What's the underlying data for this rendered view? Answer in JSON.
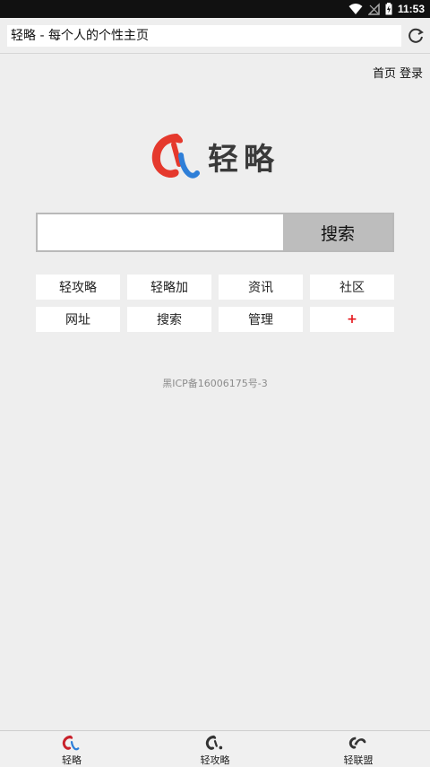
{
  "status_bar": {
    "time": "11:53",
    "icons": [
      "wifi-icon",
      "no-signal-icon",
      "battery-charging-icon"
    ]
  },
  "address_bar": {
    "title": "轻略 - 每个人的个性主页",
    "refresh_icon": "refresh-icon"
  },
  "top_links": {
    "home": "首页",
    "login": "登录"
  },
  "logo": {
    "text": "轻略",
    "colors": {
      "red": "#e5392d",
      "blue": "#2f7fd8"
    }
  },
  "search": {
    "value": "",
    "placeholder": "",
    "button_label": "搜索"
  },
  "quick_links": [
    {
      "label": "轻攻略"
    },
    {
      "label": "轻略加"
    },
    {
      "label": "资讯"
    },
    {
      "label": "社区"
    },
    {
      "label": "网址"
    },
    {
      "label": "搜索"
    },
    {
      "label": "管理"
    },
    {
      "label": "+"
    }
  ],
  "footer": {
    "icp": "黑ICP备16006175号-3"
  },
  "bottom_nav": [
    {
      "label": "轻略",
      "icon": "qinglue-logo-icon"
    },
    {
      "label": "轻攻略",
      "icon": "qinggonglue-logo-icon"
    },
    {
      "label": "轻联盟",
      "icon": "qinglianmeng-logo-icon"
    }
  ]
}
